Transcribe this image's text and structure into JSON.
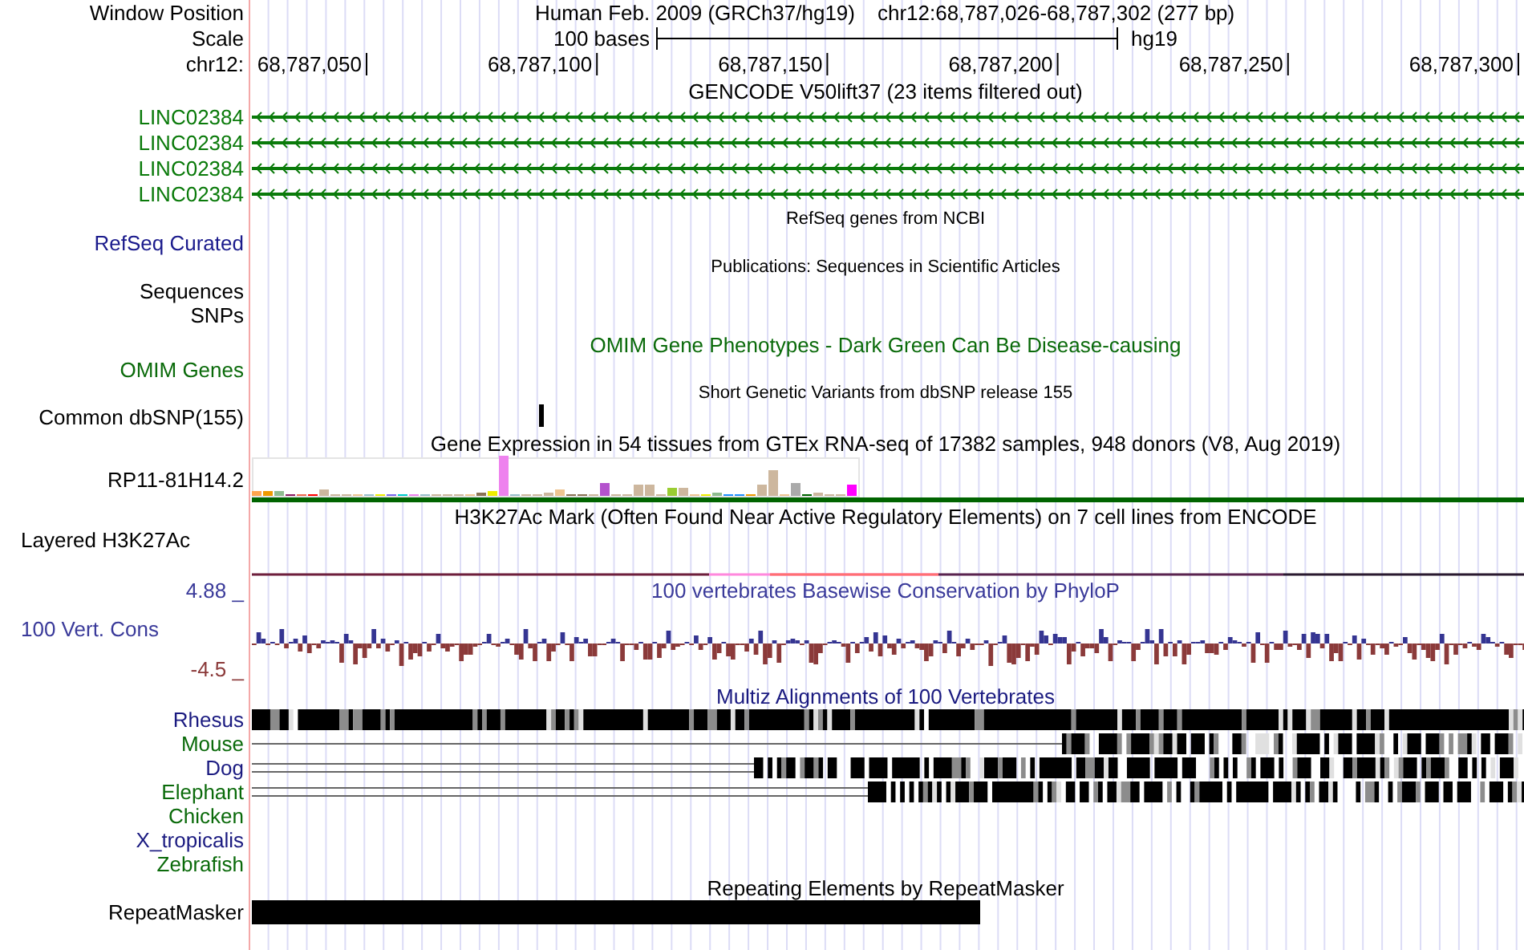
{
  "header": {
    "label": "Window Position",
    "title": "Human Feb. 2009 (GRCh37/hg19)",
    "position": "chr12:68,787,026-68,787,302 (277 bp)"
  },
  "scale": {
    "label": "Scale",
    "length": "100 bases",
    "assembly": "hg19"
  },
  "ruler": {
    "label": "chr12:",
    "ticks": [
      "68,787,050",
      "68,787,100",
      "68,787,150",
      "68,787,200",
      "68,787,250",
      "68,787,300"
    ]
  },
  "tracks": [
    {
      "kind": "gene",
      "title": {
        "text": "GENCODE V50lift37 (23 items filtered out)",
        "color": "#000000"
      },
      "items": [
        {
          "label": "LINC02384",
          "color": "#0a7a0a"
        },
        {
          "label": "LINC02384",
          "color": "#0a7a0a"
        },
        {
          "label": "LINC02384",
          "color": "#0a7a0a"
        },
        {
          "label": "LINC02384",
          "color": "#0a7a0a"
        }
      ]
    },
    {
      "kind": "note",
      "title": {
        "text": "RefSeq genes from NCBI",
        "color": "#000000"
      },
      "items": [
        {
          "label": "RefSeq Curated",
          "color": "#1a1a8c"
        }
      ]
    },
    {
      "kind": "note",
      "title": {
        "text": "Publications: Sequences in Scientific Articles",
        "color": "#000000"
      },
      "items": [
        {
          "label": "Sequences",
          "color": "#000000"
        },
        {
          "label": "SNPs",
          "color": "#000000"
        }
      ]
    },
    {
      "kind": "omim",
      "title": {
        "text": "OMIM Gene Phenotypes - Dark Green Can Be Disease-causing",
        "color": "#0a6a0a"
      },
      "items": [
        {
          "label": "OMIM Genes",
          "color": "#0a6a0a"
        }
      ]
    },
    {
      "kind": "snp",
      "title": {
        "text": "Short Genetic Variants from dbSNP release 155",
        "color": "#000000"
      },
      "items": [
        {
          "label": "Common dbSNP(155)",
          "color": "#000000"
        }
      ]
    },
    {
      "kind": "gtex",
      "title": {
        "text": "Gene Expression in 54 tissues from GTEx RNA-seq of 17382 samples, 948 donors (V8, Aug 2019)",
        "color": "#000000"
      },
      "items": [
        {
          "label": "RP11-81H14.2",
          "color": "#000000"
        }
      ]
    },
    {
      "kind": "h3k27ac",
      "title": {
        "text": "H3K27Ac Mark (Often Found Near Active Regulatory Elements) on 7 cell lines from ENCODE",
        "color": "#000000"
      },
      "items": [
        {
          "label": "Layered H3K27Ac",
          "color": "#000000"
        }
      ]
    },
    {
      "kind": "phylop",
      "title": {
        "text": "100 vertebrates Basewise Conservation by PhyloP",
        "color": "#3a3a9a"
      },
      "items": [
        {
          "label": "4.88 _",
          "color": "#3a3a9a"
        },
        {
          "label": "100 Vert. Cons",
          "color": "#3a3a9a"
        },
        {
          "label": "-4.5 _",
          "color": "#8b3a3a"
        }
      ]
    },
    {
      "kind": "multiz",
      "title": {
        "text": "Multiz Alignments of 100 Vertebrates",
        "color": "#1a1a80"
      },
      "items": [
        {
          "label": "Rhesus",
          "color": "#1a1a80"
        },
        {
          "label": "Mouse",
          "color": "#0a6a0a"
        },
        {
          "label": "Dog",
          "color": "#1a1a80"
        },
        {
          "label": "Elephant",
          "color": "#0a6a0a"
        },
        {
          "label": "Chicken",
          "color": "#0a6a0a"
        },
        {
          "label": "X_tropicalis",
          "color": "#1a1a80"
        },
        {
          "label": "Zebrafish",
          "color": "#0a6a0a"
        }
      ]
    },
    {
      "kind": "repeat",
      "title": {
        "text": "Repeating Elements by RepeatMasker",
        "color": "#000000"
      },
      "items": [
        {
          "label": "RepeatMasker",
          "color": "#000000"
        }
      ]
    }
  ]
}
